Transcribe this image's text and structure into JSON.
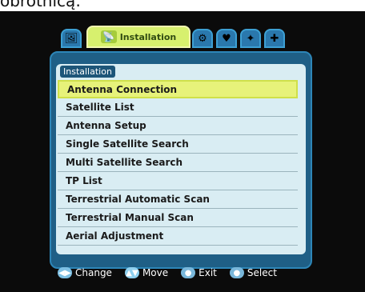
{
  "caption": {
    "text": "obrotnicą:"
  },
  "tabs": [
    {
      "id": "tab-1",
      "label": "",
      "icon": "picture-icon",
      "active": false
    },
    {
      "id": "tab-2",
      "label": "Installation",
      "icon": "satellite-dish-icon",
      "active": true
    },
    {
      "id": "tab-3",
      "label": "",
      "icon": "system-icon",
      "active": false
    },
    {
      "id": "tab-4",
      "label": "",
      "icon": "heart-icon",
      "active": false
    },
    {
      "id": "tab-5",
      "label": "",
      "icon": "settings-icon",
      "active": false
    },
    {
      "id": "tab-6",
      "label": "",
      "icon": "tools-icon",
      "active": false
    }
  ],
  "panel": {
    "title": "Installation",
    "items": [
      "Antenna Connection",
      "Satellite List",
      "Antenna Setup",
      "Single Satellite Search",
      "Multi Satellite Search",
      "TP List",
      "Terrestrial Automatic Scan",
      "Terrestrial Manual Scan",
      "Aerial Adjustment"
    ],
    "selected_index": 0
  },
  "footer": {
    "change": "Change",
    "move": "Move",
    "exit": "Exit",
    "select": "Select"
  }
}
